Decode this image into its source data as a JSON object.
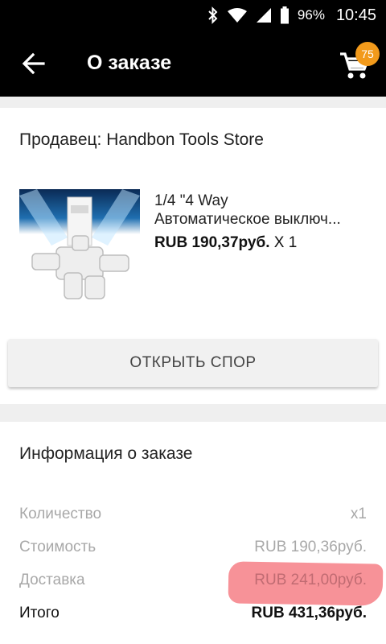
{
  "status_bar": {
    "battery": "96%",
    "time": "10:45"
  },
  "app_bar": {
    "title": "О заказе",
    "cart_count": "75"
  },
  "order_card": {
    "seller": "Продавец: Handbon Tools Store",
    "product": {
      "title_line1": "1/4 \"4 Way",
      "title_line2": "Автоматическое выключ...",
      "price": "RUB 190,37руб.",
      "quantity": "X 1"
    },
    "dispute_button": "ОТКРЫТЬ СПОР"
  },
  "order_info": {
    "title": "Информация о заказе",
    "rows": [
      {
        "label": "Количество",
        "value": "x1"
      },
      {
        "label": "Стоимость",
        "value": "RUB 190,36руб."
      },
      {
        "label": "Доставка",
        "value": "RUB 241,00руб."
      },
      {
        "label": "Итого",
        "value": "RUB 431,36руб."
      }
    ]
  },
  "colors": {
    "bar_background": "#000000",
    "badge": "#f29a1b",
    "highlight": "#f67f86"
  },
  "icons": [
    "bluetooth-icon",
    "wifi-icon",
    "signal-icon",
    "battery-icon",
    "back-arrow-icon",
    "cart-icon"
  ]
}
